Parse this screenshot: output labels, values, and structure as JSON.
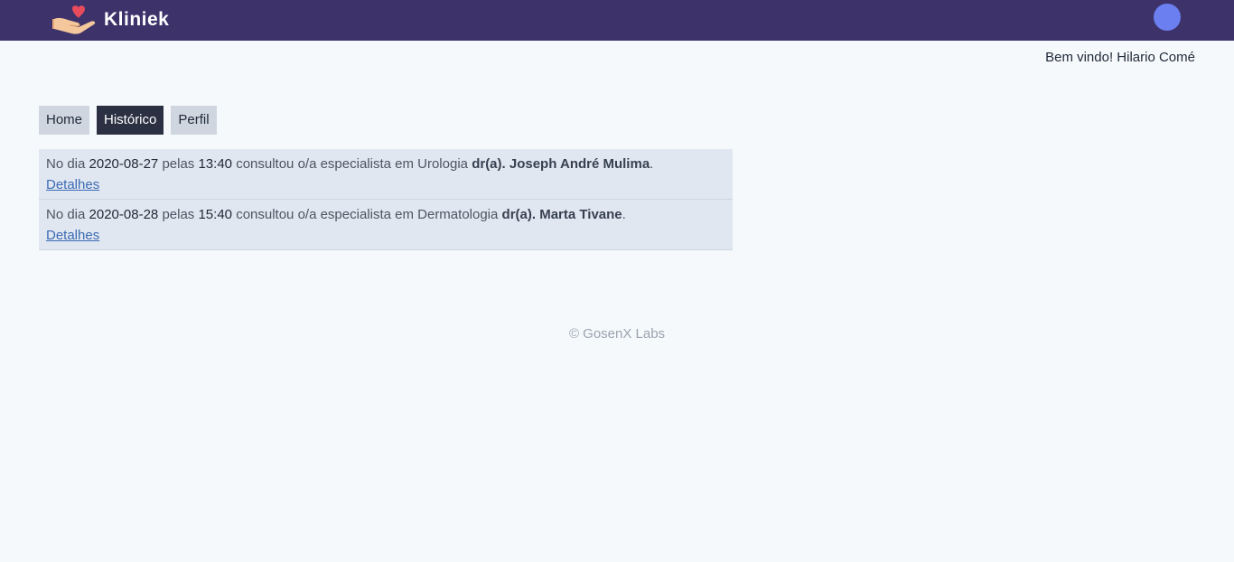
{
  "app": {
    "brand": "Kliniek"
  },
  "header": {
    "welcome": "Bem vindo! Hilario Comé"
  },
  "tabs": [
    {
      "label": "Home",
      "active": false
    },
    {
      "label": "Histórico",
      "active": true
    },
    {
      "label": "Perfil",
      "active": false
    }
  ],
  "history": [
    {
      "prefix": "No dia",
      "date": "2020-08-27",
      "at": "pelas",
      "time": "13:40",
      "middle": "consultou o/a especialista em",
      "specialty": "Urologia",
      "doctor": "dr(a). Joseph André Mulima",
      "end": ".",
      "link": "Detalhes"
    },
    {
      "prefix": "No dia",
      "date": "2020-08-28",
      "at": "pelas",
      "time": "15:40",
      "middle": "consultou o/a especialista em",
      "specialty": "Dermatologia",
      "doctor": "dr(a). Marta Tivane",
      "end": ".",
      "link": "Detalhes"
    }
  ],
  "footer": {
    "text": "© GosenX Labs"
  },
  "colors": {
    "navbar": "#3d336a",
    "avatar": "#6b7ff0",
    "active_tab": "#2b3142",
    "tab": "#cfd6e0",
    "link": "#3b6bb5"
  },
  "icons": {
    "logo": "hand-holding-heart-icon"
  }
}
